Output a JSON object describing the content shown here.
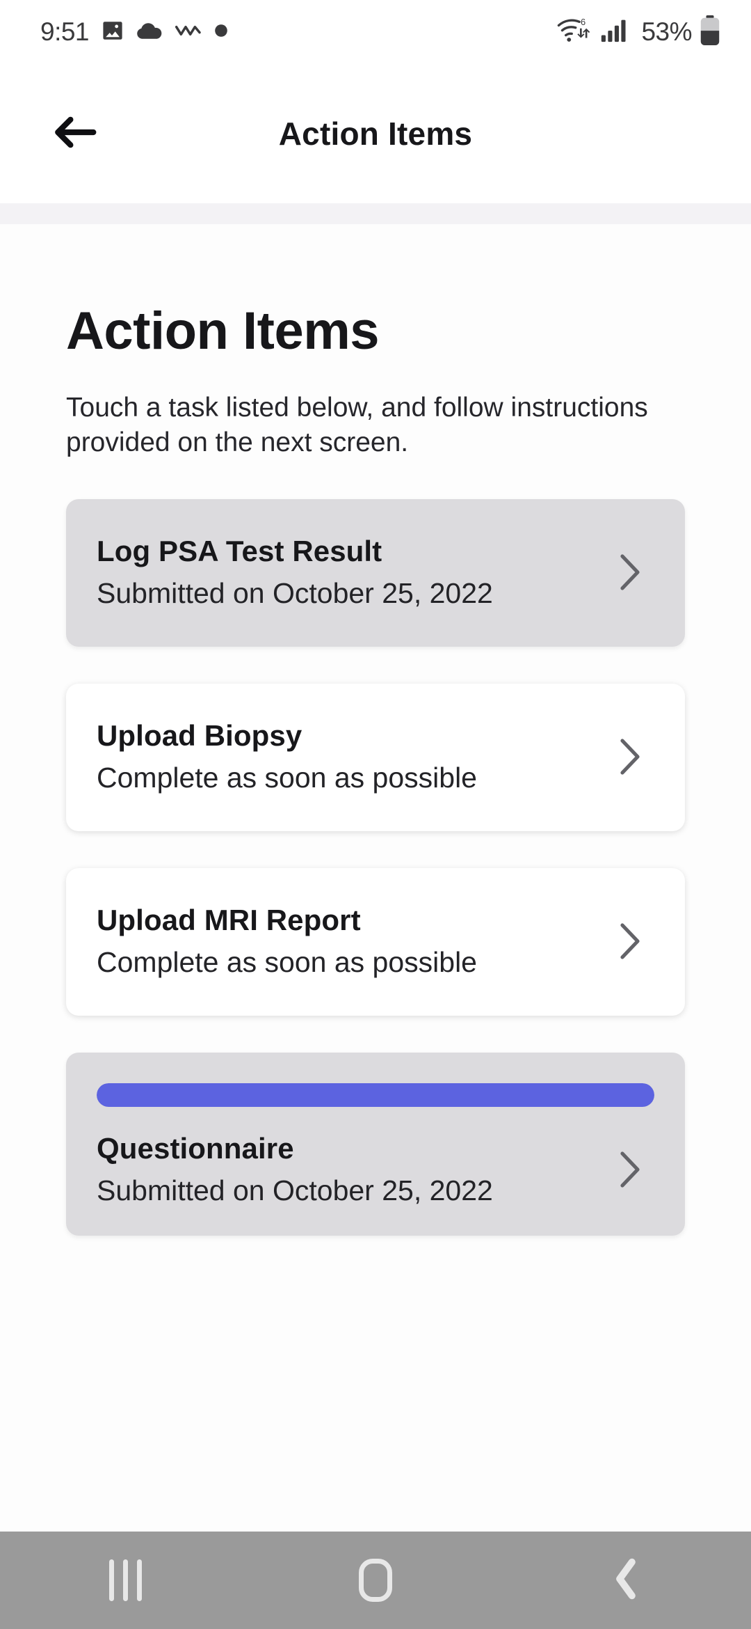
{
  "status_bar": {
    "time": "9:51",
    "left_icons": [
      "photo-icon",
      "cloud-icon",
      "activity-zigzag-icon",
      "dot-icon"
    ],
    "wifi_label": "6",
    "battery_percent": "53%",
    "right_icons": [
      "wifi-6-icon",
      "cellular-signal-icon",
      "battery-icon"
    ]
  },
  "app_bar": {
    "title": "Action Items",
    "back_icon": "arrow-left-icon"
  },
  "page": {
    "title": "Action Items",
    "description": "Touch a task listed below, and follow instructions provided on the next screen."
  },
  "tasks": [
    {
      "title": "Log PSA Test Result",
      "subtitle": "Submitted on October 25, 2022",
      "state": "done",
      "has_progress": false,
      "chevron_icon": "chevron-right-icon"
    },
    {
      "title": "Upload Biopsy",
      "subtitle": "Complete as soon as possible",
      "state": "todo",
      "has_progress": false,
      "chevron_icon": "chevron-right-icon"
    },
    {
      "title": "Upload MRI Report",
      "subtitle": "Complete as soon as possible",
      "state": "todo",
      "has_progress": false,
      "chevron_icon": "chevron-right-icon"
    },
    {
      "title": "Questionnaire",
      "subtitle": "Submitted on October 25, 2022",
      "state": "done",
      "has_progress": true,
      "progress_percent": 100,
      "chevron_icon": "chevron-right-icon"
    }
  ],
  "nav_bar": {
    "recents_label": "recents-icon",
    "home_label": "home-icon",
    "back_label": "back-icon"
  },
  "colors": {
    "accent_progress": "#5c63e0",
    "card_done_bg": "#dcdbde",
    "card_todo_bg": "#ffffff",
    "header_strip": "#f3f2f5",
    "navbar_bg": "#9a9a9a",
    "text_primary": "#17171a"
  }
}
